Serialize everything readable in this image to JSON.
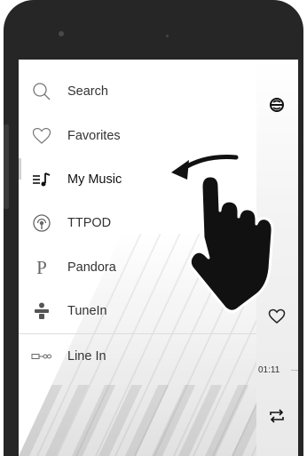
{
  "device": {
    "body_color": "#262626",
    "screen_color": "#fafafa"
  },
  "drawer": {
    "items": [
      {
        "label": "Search",
        "icon": "search-icon"
      },
      {
        "label": "Favorites",
        "icon": "heart-icon"
      },
      {
        "label": "My Music",
        "icon": "my-music-icon",
        "active": true
      },
      {
        "label": "TTPOD",
        "icon": "ttpod-icon"
      },
      {
        "label": "Pandora",
        "icon": "pandora-icon"
      },
      {
        "label": "TuneIn",
        "icon": "tunein-icon"
      },
      {
        "label": "Line In",
        "icon": "line-in-icon"
      }
    ]
  },
  "player": {
    "time": "01:11",
    "icons": [
      "source-icon",
      "heart-icon",
      "repeat-icon"
    ]
  },
  "overlay": {
    "gesture": "swipe-left-hand-icon"
  }
}
